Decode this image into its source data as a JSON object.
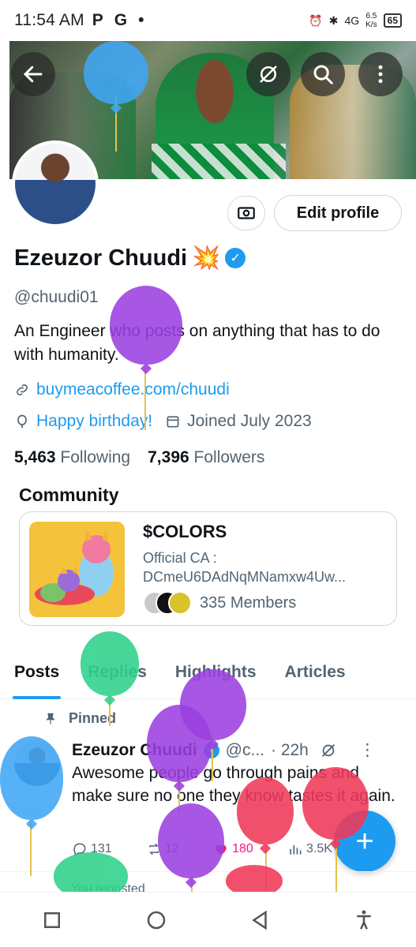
{
  "status_bar": {
    "time": "11:54 AM",
    "indicators": [
      "P",
      "G",
      "•"
    ],
    "network": "4G",
    "speed_top": "6.5",
    "speed_bottom": "K/s",
    "battery": "65"
  },
  "banner": {
    "icons": [
      "back-arrow-icon",
      "grok-icon",
      "search-icon",
      "more-icon"
    ]
  },
  "profile": {
    "edit_label": "Edit profile",
    "name": "Ezeuzor Chuudi",
    "emoji": "💥",
    "handle": "@chuudi01",
    "bio": "An Engineer who posts on anything that has to do with humanity.",
    "link": "buymeacoffee.com/chuudi",
    "birthday": "Happy birthday!",
    "joined": "Joined July 2023",
    "following_count": "5,463",
    "following_label": "Following",
    "followers_count": "7,396",
    "followers_label": "Followers"
  },
  "community": {
    "title": "Community",
    "name": "$COLORS",
    "desc_line1": "Official CA :",
    "desc_line2": "DCmeU6DAdNqMNamxw4Uw...",
    "members": "335 Members"
  },
  "tabs": [
    "Posts",
    "Replies",
    "Highlights",
    "Articles"
  ],
  "post": {
    "pinned_label": "Pinned",
    "author": "Ezeuzor Chuudi",
    "handle": "@c...",
    "time": "· 22h",
    "text": "Awesome people go through pains and make sure no one they know tastes it again.",
    "replies": "131",
    "reposts": "12",
    "likes": "180",
    "views": "3.5K"
  },
  "next_post_hint": "You reposted",
  "colors": {
    "accent": "#1d9bf0",
    "like": "#f91880"
  }
}
